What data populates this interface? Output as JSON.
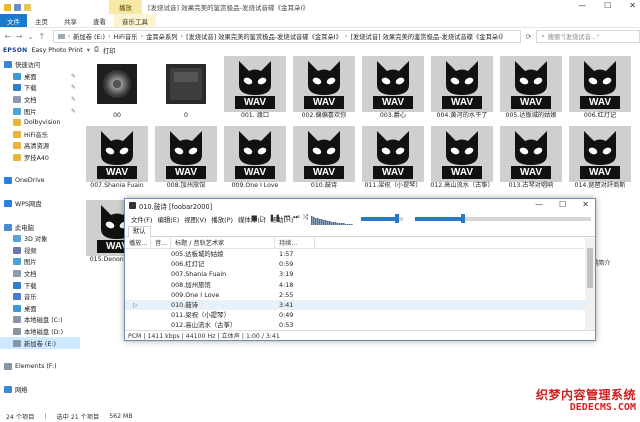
{
  "window": {
    "context_tab": "播放",
    "title": "[发烧试音] 效果完美的鉴赏极品-发烧试音碟《金耳朵Ⅰ》",
    "controls": [
      "—",
      "☐",
      "✕"
    ]
  },
  "ribbon": {
    "tabs": [
      "文件",
      "主页",
      "共享",
      "查看",
      "音乐工具"
    ]
  },
  "address": {
    "crumbs": [
      "新加卷 (E:)",
      "HiFi音乐",
      "金耳朵系列",
      "[发烧试音] 效果完美的鉴赏极品-发烧试音碟《金耳朵Ⅰ》",
      "[发烧试音] 效果完美的鉴赏极品-发烧试音碟《金耳朵Ⅰ》"
    ],
    "search_placeholder": "搜索\"[发烧试音...\""
  },
  "toolbar": {
    "brand": "EPSON",
    "app": "Easy Photo Print",
    "print": "打印"
  },
  "nav": {
    "items": [
      {
        "label": "快速访问",
        "icon": "star-icon",
        "sub": false,
        "pin": false
      },
      {
        "label": "桌面",
        "icon": "desktop-icon",
        "sub": true,
        "pin": true
      },
      {
        "label": "下载",
        "icon": "download-icon",
        "sub": true,
        "pin": true
      },
      {
        "label": "文档",
        "icon": "document-icon",
        "sub": true,
        "pin": true
      },
      {
        "label": "图片",
        "icon": "picture-icon",
        "sub": true,
        "pin": true
      },
      {
        "label": "Dolbyvision",
        "icon": "folder-icon",
        "sub": true,
        "pin": false
      },
      {
        "label": "HiFi音乐",
        "icon": "folder-icon",
        "sub": true,
        "pin": false
      },
      {
        "label": "高清资源",
        "icon": "folder-icon",
        "sub": true,
        "pin": false
      },
      {
        "label": "罗技A40",
        "icon": "folder-icon",
        "sub": true,
        "pin": false
      },
      {
        "label": "",
        "icon": "",
        "sub": false,
        "pin": false
      },
      {
        "label": "OneDrive",
        "icon": "cloud-icon",
        "sub": false,
        "pin": false
      },
      {
        "label": "",
        "icon": "",
        "sub": false,
        "pin": false
      },
      {
        "label": "WPS网盘",
        "icon": "cloud-icon",
        "sub": false,
        "pin": false
      },
      {
        "label": "",
        "icon": "",
        "sub": false,
        "pin": false
      },
      {
        "label": "此电脑",
        "icon": "computer-icon",
        "sub": false,
        "pin": false
      },
      {
        "label": "3D 对象",
        "icon": "cube-icon",
        "sub": true,
        "pin": false
      },
      {
        "label": "视频",
        "icon": "video-icon",
        "sub": true,
        "pin": false
      },
      {
        "label": "图片",
        "icon": "picture-icon",
        "sub": true,
        "pin": false
      },
      {
        "label": "文档",
        "icon": "document-icon",
        "sub": true,
        "pin": false
      },
      {
        "label": "下载",
        "icon": "download-icon",
        "sub": true,
        "pin": false
      },
      {
        "label": "音乐",
        "icon": "music-icon",
        "sub": true,
        "pin": false
      },
      {
        "label": "桌面",
        "icon": "desktop-icon",
        "sub": true,
        "pin": false
      },
      {
        "label": "本地磁盘 (C:)",
        "icon": "drive-icon",
        "sub": true,
        "pin": false
      },
      {
        "label": "本地磁盘 (D:)",
        "icon": "drive-icon",
        "sub": true,
        "pin": false
      },
      {
        "label": "新加卷 (E:)",
        "icon": "drive-icon",
        "sub": true,
        "pin": false,
        "selected": true
      },
      {
        "label": "",
        "icon": "",
        "sub": false,
        "pin": false
      },
      {
        "label": "Elements (F:)",
        "icon": "drive-icon",
        "sub": false,
        "pin": false
      },
      {
        "label": "",
        "icon": "",
        "sub": false,
        "pin": false
      },
      {
        "label": "网络",
        "icon": "network-icon",
        "sub": false,
        "pin": false
      }
    ]
  },
  "files": [
    {
      "name": "00",
      "kind": "cover"
    },
    {
      "name": "0",
      "kind": "disc"
    },
    {
      "name": "001. 渡口",
      "kind": "wav"
    },
    {
      "name": "002.偏偏喜欢你",
      "kind": "wav"
    },
    {
      "name": "003.爵心",
      "kind": "wav"
    },
    {
      "name": "004.黄河的水干了",
      "kind": "wav"
    },
    {
      "name": "005.达板城的姑娘",
      "kind": "wav"
    },
    {
      "name": "006.红灯记",
      "kind": "wav"
    },
    {
      "name": "007.Shania Fuain",
      "kind": "wav"
    },
    {
      "name": "008.加州旅馆",
      "kind": "wav"
    },
    {
      "name": "009.One I Love",
      "kind": "wav"
    },
    {
      "name": "010.鼓诗",
      "kind": "wav"
    },
    {
      "name": "011.梁祝（小提琴）",
      "kind": "wav"
    },
    {
      "name": "012.高山流水（古筝）",
      "kind": "wav"
    },
    {
      "name": "013.古琴对唱响",
      "kind": "wav"
    },
    {
      "name": "014.琵琶对評商斯",
      "kind": "wav"
    },
    {
      "name": "015.Denon 管弦乐",
      "kind": "wav"
    }
  ],
  "file_wav_label": "WAV",
  "stray_label": "唱简介",
  "status": {
    "count": "24 个项目",
    "selected": "选中 21 个项目",
    "size": "562 MB"
  },
  "foobar": {
    "title": "010.鼓诗 [foobar2000]",
    "menu": [
      "文件(F)",
      "编辑(E)",
      "视图(V)",
      "播放(P)",
      "媒体库(L)",
      "帮助(H)"
    ],
    "tab": "默认",
    "columns": [
      "播放...",
      "音...",
      "标题 / 音轨艺术家",
      "持续..."
    ],
    "rows": [
      {
        "title": "005.达板城的姑娘",
        "duration": "1:57"
      },
      {
        "title": "006.红灯记",
        "duration": "0:59"
      },
      {
        "title": "007.Shania Fuain",
        "duration": "3:19"
      },
      {
        "title": "008.加州旅馆",
        "duration": "4:18"
      },
      {
        "title": "009.One I Love",
        "duration": "2:55"
      },
      {
        "title": "010.鼓诗",
        "duration": "3:41",
        "playing": true
      },
      {
        "title": "011.梁祝（小提琴）",
        "duration": "0:49"
      },
      {
        "title": "012.高山流水（古筝）",
        "duration": "0:53"
      }
    ],
    "play_marker": "▷",
    "status": "PCM | 1411 kbps | 44100 Hz | 立体声 | 1:00 / 3:41",
    "volume_fraction": 0.85,
    "seek_fraction": 0.27,
    "accent_color": "#2a78c8"
  },
  "watermark": {
    "line1": "织梦内容管理系统",
    "line2": "DEDECMS.COM"
  }
}
